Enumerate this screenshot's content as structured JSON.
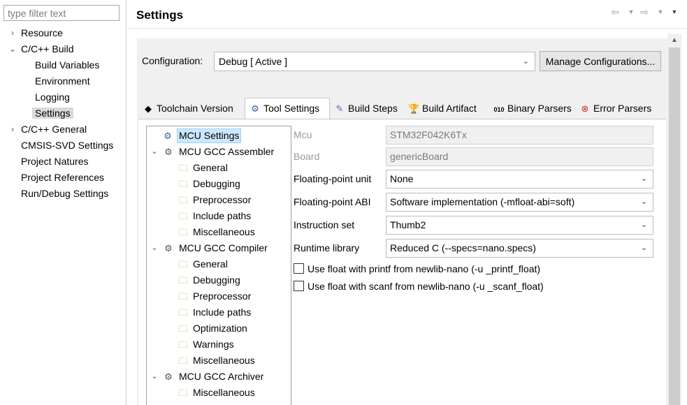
{
  "filter": {
    "placeholder": "type filter text"
  },
  "nav": [
    {
      "label": "Resource",
      "chevron": "›",
      "expanded": false
    },
    {
      "label": "C/C++ Build",
      "chevron": "⌄",
      "expanded": true
    },
    {
      "label": "Build Variables"
    },
    {
      "label": "Environment"
    },
    {
      "label": "Logging"
    },
    {
      "label": "Settings",
      "selected": true
    },
    {
      "label": "C/C++ General",
      "chevron": "›",
      "expanded": false
    },
    {
      "label": "CMSIS-SVD Settings"
    },
    {
      "label": "Project Natures"
    },
    {
      "label": "Project References"
    },
    {
      "label": "Run/Debug Settings"
    }
  ],
  "header": {
    "title": "Settings"
  },
  "configuration": {
    "label": "Configuration:",
    "value": "Debug  [ Active ]",
    "manage_button": "Manage Configurations..."
  },
  "tabs": [
    {
      "label": "Toolchain  Version",
      "icon": "toolchain-icon"
    },
    {
      "label": "Tool Settings",
      "icon": "tool-settings-icon",
      "active": true
    },
    {
      "label": "Build Steps",
      "icon": "build-steps-icon"
    },
    {
      "label": "Build Artifact",
      "icon": "build-artifact-icon"
    },
    {
      "label": "Binary Parsers",
      "icon": "binary-parsers-icon"
    },
    {
      "label": "Error Parsers",
      "icon": "error-parsers-icon"
    }
  ],
  "tree": {
    "mcu_settings": "MCU Settings",
    "assembler": {
      "label": "MCU GCC Assembler",
      "children": [
        "General",
        "Debugging",
        "Preprocessor",
        "Include paths",
        "Miscellaneous"
      ]
    },
    "compiler": {
      "label": "MCU GCC Compiler",
      "children": [
        "General",
        "Debugging",
        "Preprocessor",
        "Include paths",
        "Optimization",
        "Warnings",
        "Miscellaneous"
      ]
    },
    "archiver": {
      "label": "MCU GCC Archiver",
      "children": [
        "Miscellaneous"
      ]
    }
  },
  "form": {
    "mcu": {
      "label": "Mcu",
      "value": "STM32F042K6Tx"
    },
    "board": {
      "label": "Board",
      "value": "genericBoard"
    },
    "fpu": {
      "label": "Floating-point unit",
      "value": "None"
    },
    "fpabi": {
      "label": "Floating-point ABI",
      "value": "Software implementation (-mfloat-abi=soft)"
    },
    "instruction_set": {
      "label": "Instruction set",
      "value": "Thumb2"
    },
    "runtime": {
      "label": "Runtime library",
      "value": "Reduced C (--specs=nano.specs)"
    },
    "printf_float": {
      "label": "Use float with printf from newlib-nano (-u _printf_float)",
      "checked": false
    },
    "scanf_float": {
      "label": "Use float with scanf from newlib-nano (-u _scanf_float)",
      "checked": false
    }
  },
  "colors": {
    "tree_selection": "#cce8ff",
    "nav_selection": "#dadada",
    "panel_bg": "#f0f0f0"
  }
}
